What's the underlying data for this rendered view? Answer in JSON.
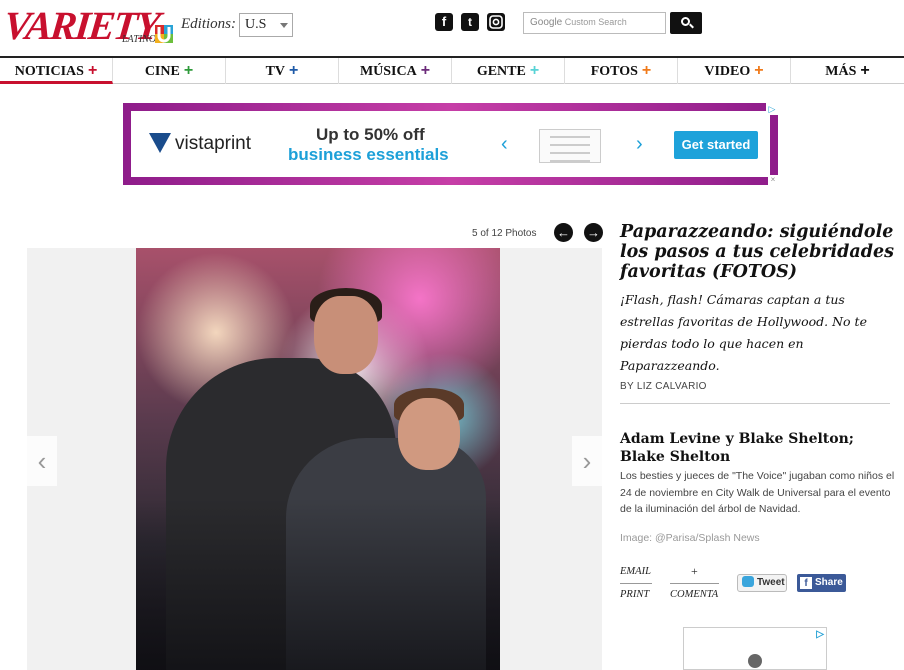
{
  "header": {
    "logo_text": "VARIETY",
    "logo_sub": "LATINO",
    "editions_label": "Editions:",
    "editions_value": "U.S",
    "search_placeholder": "Custom Search",
    "search_brand": "Google"
  },
  "nav": [
    {
      "label": "NOTICIAS",
      "plus_color": "#c8102e"
    },
    {
      "label": "CINE",
      "plus_color": "#2e9a3a"
    },
    {
      "label": "TV",
      "plus_color": "#1e5aa8"
    },
    {
      "label": "MÚSICA",
      "plus_color": "#6b2a7a"
    },
    {
      "label": "GENTE",
      "plus_color": "#58d3d6"
    },
    {
      "label": "FOTOS",
      "plus_color": "#f07a1a"
    },
    {
      "label": "VIDEO",
      "plus_color": "#f07a1a"
    },
    {
      "label": "MÁS",
      "plus_color": "#111111"
    }
  ],
  "ad": {
    "brand": "vistaprint",
    "headline1": "Up to 50% off",
    "headline2": "business essentials",
    "cta": "Get started"
  },
  "gallery": {
    "counter": "5 of 12 Photos"
  },
  "article": {
    "title": "Paparazzeando: siguiéndole los pasos a tus celebridades favoritas (FOTOS)",
    "dek": "¡Flash, flash! Cámaras captan a tus estrellas favoritas de Hollywood. No te pierdas todo lo que hacen en Paparazzeando.",
    "byline": "BY LIZ CALVARIO"
  },
  "caption": {
    "title": "Adam Levine y Blake Shelton; Blake Shelton",
    "text": "Los besties y jueces de \"The Voice\" jugaban como niños el 24 de noviembre en City Walk de Universal para el evento de la iluminación del árbol de Navidad.",
    "credit": "Image: @Parisa/Splash News"
  },
  "share": {
    "email_label": "EMAIL",
    "print_label": "PRINT",
    "plus_label": "+",
    "comment_label": "COMENTA",
    "tweet_label": "Tweet",
    "fb_label": "Share"
  }
}
